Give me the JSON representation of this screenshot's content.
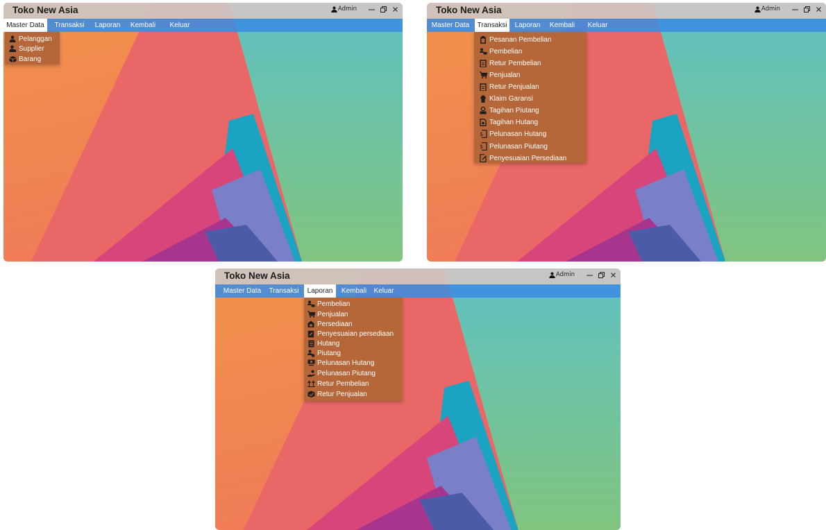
{
  "app": {
    "title": "Toko New Asia",
    "user": "Admin"
  },
  "menu": [
    "Master Data",
    "Transaksi",
    "Laporan",
    "Kembali",
    "Keluar"
  ],
  "master_data_menu": [
    {
      "label": "Pelanggan",
      "icon": "user-icon"
    },
    {
      "label": "Supplier",
      "icon": "supplier-icon"
    },
    {
      "label": "Barang",
      "icon": "box-icon"
    }
  ],
  "transaksi_menu": [
    {
      "label": "Pesanan Pembelian",
      "icon": "clipboard-icon"
    },
    {
      "label": "Pembelian",
      "icon": "cart-user-icon"
    },
    {
      "label": "Retur Pembelian",
      "icon": "return-doc-icon"
    },
    {
      "label": "Penjualan",
      "icon": "cart-icon"
    },
    {
      "label": "Retur Penjualan",
      "icon": "return-doc-icon"
    },
    {
      "label": "Klaim Garansi",
      "icon": "warranty-icon"
    },
    {
      "label": "Tagihan Piutang",
      "icon": "bill-icon"
    },
    {
      "label": "Tagihan Hutang",
      "icon": "invoice-icon"
    },
    {
      "label": "Pelunasan Hutang",
      "icon": "payment-doc-icon"
    },
    {
      "label": "Pelunasan Piutang",
      "icon": "payment-doc-icon"
    },
    {
      "label": "Penyesuaian Persediaan",
      "icon": "edit-doc-icon"
    }
  ],
  "laporan_menu": [
    {
      "label": "Pembelian",
      "icon": "cart-user-icon"
    },
    {
      "label": "Penjualan",
      "icon": "cart-icon"
    },
    {
      "label": "Persediaan",
      "icon": "inventory-icon"
    },
    {
      "label": "Penyesuaian persediaan",
      "icon": "edit-doc-icon"
    },
    {
      "label": "Hutang",
      "icon": "ledger-icon"
    },
    {
      "label": "Piutang",
      "icon": "user-money-icon"
    },
    {
      "label": "Pelunasan Hutang",
      "icon": "money-icon"
    },
    {
      "label": "Pelunasan Piutang",
      "icon": "hand-money-icon"
    },
    {
      "label": "Retur Pembelian",
      "icon": "return-icon"
    },
    {
      "label": "Retur Penjualan",
      "icon": "return-box-icon"
    }
  ],
  "colors": {
    "titlebar": "#cdc6c4",
    "menubar": "#3c8ce1",
    "dropdown": "#b5673a",
    "accent_orange": "#f0904a",
    "accent_teal": "#62c6c0"
  }
}
